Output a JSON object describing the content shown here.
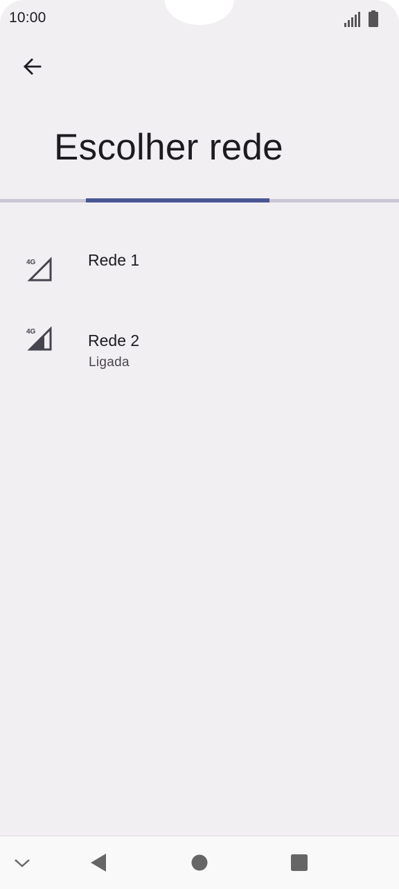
{
  "status_bar": {
    "time": "10:00",
    "icons": [
      "signal-icon",
      "battery-icon"
    ]
  },
  "header": {
    "back_icon": "arrow-left-icon",
    "title": "Escolher rede"
  },
  "progress": {
    "indeterminate": true
  },
  "networks": [
    {
      "icon": "4g-signal-outline-icon",
      "badge": "4G",
      "name": "Rede 1",
      "status": ""
    },
    {
      "icon": "4g-signal-partial-icon",
      "badge": "4G",
      "name": "Rede 2",
      "status": "Ligada"
    }
  ],
  "nav_bar": {
    "icons": [
      "chevron-down-icon",
      "back-triangle-icon",
      "home-circle-icon",
      "recents-square-icon"
    ]
  },
  "colors": {
    "background": "#f2eff3",
    "progress_track": "#c9c7d4",
    "progress_indicator": "#4a5694",
    "text_primary": "#1c1b1f",
    "text_secondary": "#49454f"
  }
}
